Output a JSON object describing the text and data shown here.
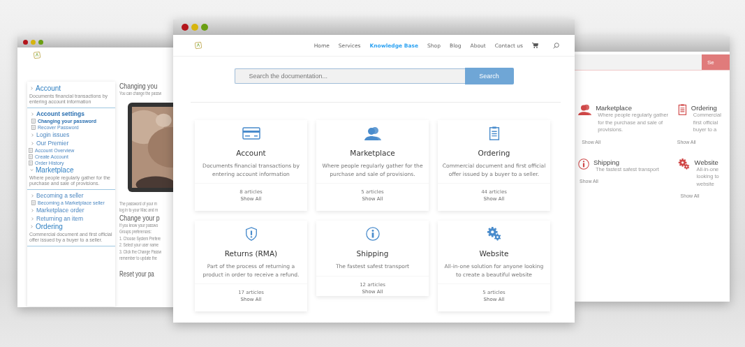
{
  "left_window": {
    "sidebar": [
      {
        "title": "Account",
        "expanded": false,
        "description": "Documents financial transactions by entering account information",
        "items": [
          {
            "kind": "folder",
            "label": "Account settings",
            "selected": true,
            "children": [
              {
                "kind": "page",
                "label": "Changing your password",
                "selected": true
              },
              {
                "kind": "page",
                "label": "Recover Password",
                "selected": false
              }
            ]
          },
          {
            "kind": "folder",
            "label": "Login issues",
            "selected": false
          },
          {
            "kind": "folder",
            "label": "Our Premier",
            "selected": false
          },
          {
            "kind": "page",
            "label": "Account Overview",
            "selected": false
          },
          {
            "kind": "page",
            "label": "Create Account",
            "selected": false
          },
          {
            "kind": "page",
            "label": "Order History",
            "selected": false
          }
        ]
      },
      {
        "title": "Marketplace",
        "expanded": true,
        "description": "Where people regularly gather for the purchase and sale of provisions.",
        "items": [
          {
            "kind": "folder",
            "label": "Becoming a seller",
            "selected": false,
            "children": [
              {
                "kind": "page",
                "label": "Becoming a Marketplace seller",
                "selected": false
              }
            ]
          },
          {
            "kind": "folder",
            "label": "Marketplace order",
            "selected": false
          },
          {
            "kind": "folder",
            "label": "Returning an item",
            "selected": false
          }
        ]
      },
      {
        "title": "Ordering",
        "expanded": false,
        "description": "Commercial document and first official offer issued by a buyer to a seller."
      }
    ],
    "article": {
      "title": "Changing you",
      "intro": "You can change the passw",
      "body": [
        "The password of your m",
        "log in to your Mac and m"
      ],
      "subtitle": "Change your p",
      "steps": [
        "If you know your passwo",
        "Groups preferences:",
        "1. Choose System Prefere",
        "2. Select your user name",
        "3. Click the Change Passw",
        "remember to update the"
      ],
      "next_title": "Reset your pa"
    }
  },
  "right_window": {
    "search_button": "Se",
    "cards": [
      {
        "kind": "people",
        "title": "Marketplace",
        "lines": [
          "Where people regularly gather",
          "for the purchase and sale of",
          "provisions."
        ],
        "link": "Show All"
      },
      {
        "kind": "clipboard",
        "title": "Ordering",
        "lines": [
          "Commercial",
          "first official",
          "buyer to a"
        ],
        "link": "Show All"
      },
      {
        "kind": "info",
        "title": "Shipping",
        "lines": [
          "The fastest safest transport"
        ],
        "link": "Show All"
      },
      {
        "kind": "gears",
        "title": "Website",
        "lines": [
          "All-in-one",
          "looking to",
          "website"
        ],
        "link": "Show All"
      }
    ]
  },
  "main_window": {
    "nav": [
      {
        "label": "Home",
        "selected": false
      },
      {
        "label": "Services",
        "selected": false
      },
      {
        "label": "Knowledge Base",
        "selected": true
      },
      {
        "label": "Shop",
        "selected": false
      },
      {
        "label": "Blog",
        "selected": false
      },
      {
        "label": "About",
        "selected": false
      },
      {
        "label": "Contact us",
        "selected": false
      }
    ],
    "search": {
      "placeholder": "Search the documentation...",
      "button": "Search"
    },
    "cards": [
      {
        "kind": "card",
        "title": "Account",
        "description": "Documents financial transactions by entering account information",
        "count": "8 articles",
        "link": "Show All"
      },
      {
        "kind": "people",
        "title": "Marketplace",
        "description": "Where people regularly gather for the purchase and sale of provisions.",
        "count": "5 articles",
        "link": "Show All"
      },
      {
        "kind": "clipboard",
        "title": "Ordering",
        "description": "Commercial document and first official offer issued by a buyer to a seller.",
        "count": "44 articles",
        "link": "Show All"
      },
      {
        "kind": "shield",
        "title": "Returns (RMA)",
        "description": "Part of the process of returning a product in order to receive a refund.",
        "count": "17 articles",
        "link": "Show All"
      },
      {
        "kind": "info",
        "title": "Shipping",
        "description": "The fastest safest transport",
        "count": "12 articles",
        "link": "Show All"
      },
      {
        "kind": "gears",
        "title": "Website",
        "description": "All-in-one solution for anyone looking to create a beautiful website",
        "count": "5 articles",
        "link": "Show All"
      }
    ]
  }
}
